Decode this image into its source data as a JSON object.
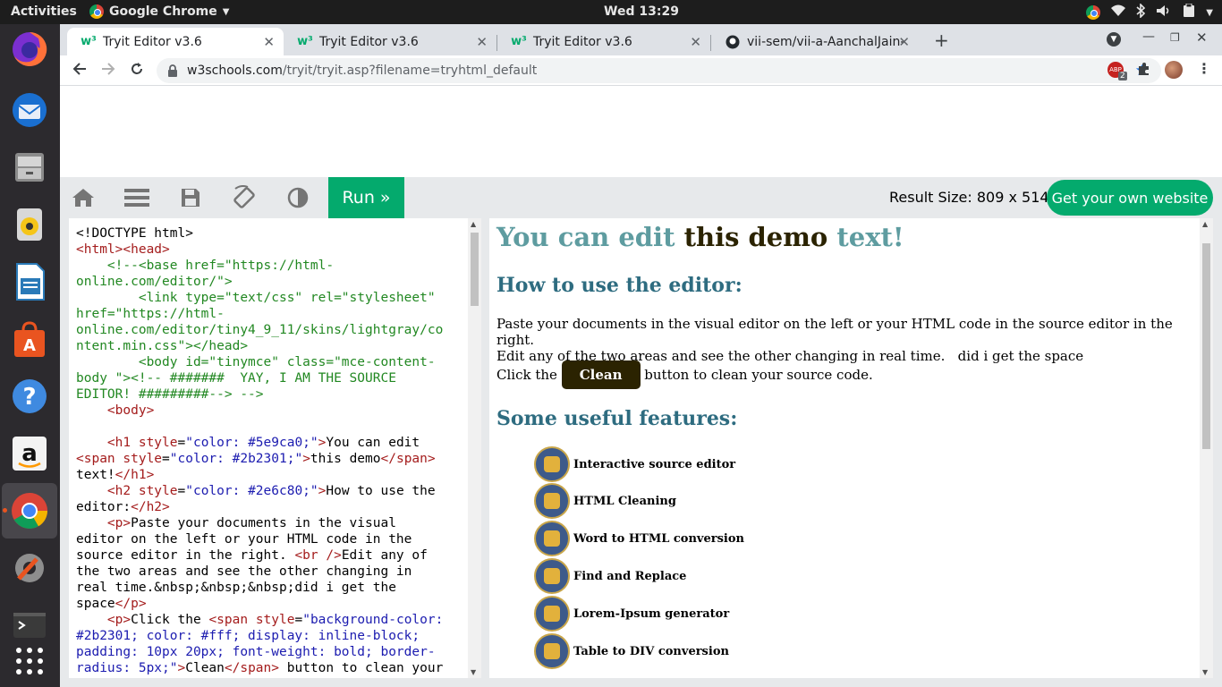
{
  "topbar": {
    "activities": "Activities",
    "app_menu": "Google Chrome",
    "clock": "Wed 13:29"
  },
  "dock": {
    "items": [
      "firefox-icon",
      "thunderbird-icon",
      "files-icon",
      "rhythmbox-icon",
      "libreoffice-writer-icon",
      "software-icon",
      "help-icon",
      "amazon-icon",
      "chrome-icon",
      "settings-icon",
      "terminal-icon",
      "app-grid-icon"
    ]
  },
  "browser": {
    "tabs": [
      {
        "label": "Tryit Editor v3.6",
        "favicon": "w3"
      },
      {
        "label": "Tryit Editor v3.6",
        "favicon": "w3"
      },
      {
        "label": "Tryit Editor v3.6",
        "favicon": "w3"
      },
      {
        "label": "vii-sem/vii-a-AanchalJain-",
        "favicon": "github"
      }
    ],
    "url_host": "w3schools.com",
    "url_path": "/tryit/tryit.asp?filename=tryhtml_default",
    "ext_badge": "2"
  },
  "tryit": {
    "run_label": "Run »",
    "result_size": "Result Size: 809 x 514",
    "own_site_label": "Get your own website"
  },
  "code_lines": [
    [
      [
        "tx",
        "<!DOCTYPE html>"
      ]
    ],
    [
      [
        "tg",
        "<html><head>"
      ]
    ],
    [
      [
        "cm",
        "    <!--<base href=\"https://html-"
      ]
    ],
    [
      [
        "cm",
        "online.com/editor/\">"
      ]
    ],
    [
      [
        "cm",
        "        <link type=\"text/css\" rel=\"stylesheet\""
      ]
    ],
    [
      [
        "cm",
        "href=\"https://html-"
      ]
    ],
    [
      [
        "cm",
        "online.com/editor/tiny4_9_11/skins/lightgray/co"
      ]
    ],
    [
      [
        "cm",
        "ntent.min.css\"></head>"
      ]
    ],
    [
      [
        "cm",
        "        <body id=\"tinymce\" class=\"mce-content-"
      ]
    ],
    [
      [
        "cm",
        "body \"><!-- #######  YAY, I AM THE SOURCE"
      ]
    ],
    [
      [
        "cm",
        "EDITOR! #########--> -->"
      ]
    ],
    [
      [
        "tx",
        "    "
      ],
      [
        "tg",
        "<body>"
      ]
    ],
    [
      [
        "tx",
        ""
      ]
    ],
    [
      [
        "tx",
        "    "
      ],
      [
        "tg",
        "<h1 "
      ],
      [
        "at",
        "style"
      ],
      [
        "tx",
        "="
      ],
      [
        "av",
        "\"color: #5e9ca0;\""
      ],
      [
        "tg",
        ">"
      ],
      [
        "tx",
        "You can edit"
      ]
    ],
    [
      [
        "tg",
        "<span "
      ],
      [
        "at",
        "style"
      ],
      [
        "tx",
        "="
      ],
      [
        "av",
        "\"color: #2b2301;\""
      ],
      [
        "tg",
        ">"
      ],
      [
        "tx",
        "this demo"
      ],
      [
        "tg",
        "</span>"
      ]
    ],
    [
      [
        "tx",
        "text!"
      ],
      [
        "tg",
        "</h1>"
      ]
    ],
    [
      [
        "tx",
        "    "
      ],
      [
        "tg",
        "<h2 "
      ],
      [
        "at",
        "style"
      ],
      [
        "tx",
        "="
      ],
      [
        "av",
        "\"color: #2e6c80;\""
      ],
      [
        "tg",
        ">"
      ],
      [
        "tx",
        "How to use the"
      ]
    ],
    [
      [
        "tx",
        "editor:"
      ],
      [
        "tg",
        "</h2>"
      ]
    ],
    [
      [
        "tx",
        "    "
      ],
      [
        "tg",
        "<p>"
      ],
      [
        "tx",
        "Paste your documents in the visual"
      ]
    ],
    [
      [
        "tx",
        "editor on the left or your HTML code in the"
      ]
    ],
    [
      [
        "tx",
        "source editor in the right. "
      ],
      [
        "tg",
        "<br />"
      ],
      [
        "tx",
        "Edit any of"
      ]
    ],
    [
      [
        "tx",
        "the two areas and see the other changing in"
      ]
    ],
    [
      [
        "tx",
        "real time.&nbsp;&nbsp;&nbsp;did i get the"
      ]
    ],
    [
      [
        "tx",
        "space"
      ],
      [
        "tg",
        "</p>"
      ]
    ],
    [
      [
        "tx",
        "    "
      ],
      [
        "tg",
        "<p>"
      ],
      [
        "tx",
        "Click the "
      ],
      [
        "tg",
        "<span "
      ],
      [
        "at",
        "style"
      ],
      [
        "tx",
        "="
      ],
      [
        "av",
        "\"background-color:"
      ]
    ],
    [
      [
        "av",
        "#2b2301; color: #fff; display: inline-block;"
      ]
    ],
    [
      [
        "av",
        "padding: 10px 20px; font-weight: bold; border-"
      ]
    ],
    [
      [
        "av",
        "radius: 5px;\""
      ],
      [
        "tg",
        ">"
      ],
      [
        "tx",
        "Clean"
      ],
      [
        "tg",
        "</span>"
      ],
      [
        "tx",
        " button to clean your"
      ]
    ]
  ],
  "result": {
    "h1_part1": "You can edit",
    "h1_part2": "this demo",
    "h1_part3": "text!",
    "h1_color": "#5e9ca0",
    "span_color": "#2b2301",
    "h2_color": "#2e6c80",
    "h2_how": "How to use the editor:",
    "p1_line1": "Paste your documents in the visual editor on the left or your HTML code in the source editor in the right.",
    "p1_line2": "Edit any of the two areas and see the other changing in real time.   did i get the space",
    "p2_before": "Click the",
    "p2_badge": "Clean",
    "p2_after": "button to clean your source code.",
    "h2_features": "Some useful features:",
    "features": [
      "Interactive source editor",
      "HTML Cleaning",
      "Word to HTML conversion",
      "Find and Replace",
      "Lorem-Ipsum generator",
      "Table to DIV conversion"
    ]
  }
}
